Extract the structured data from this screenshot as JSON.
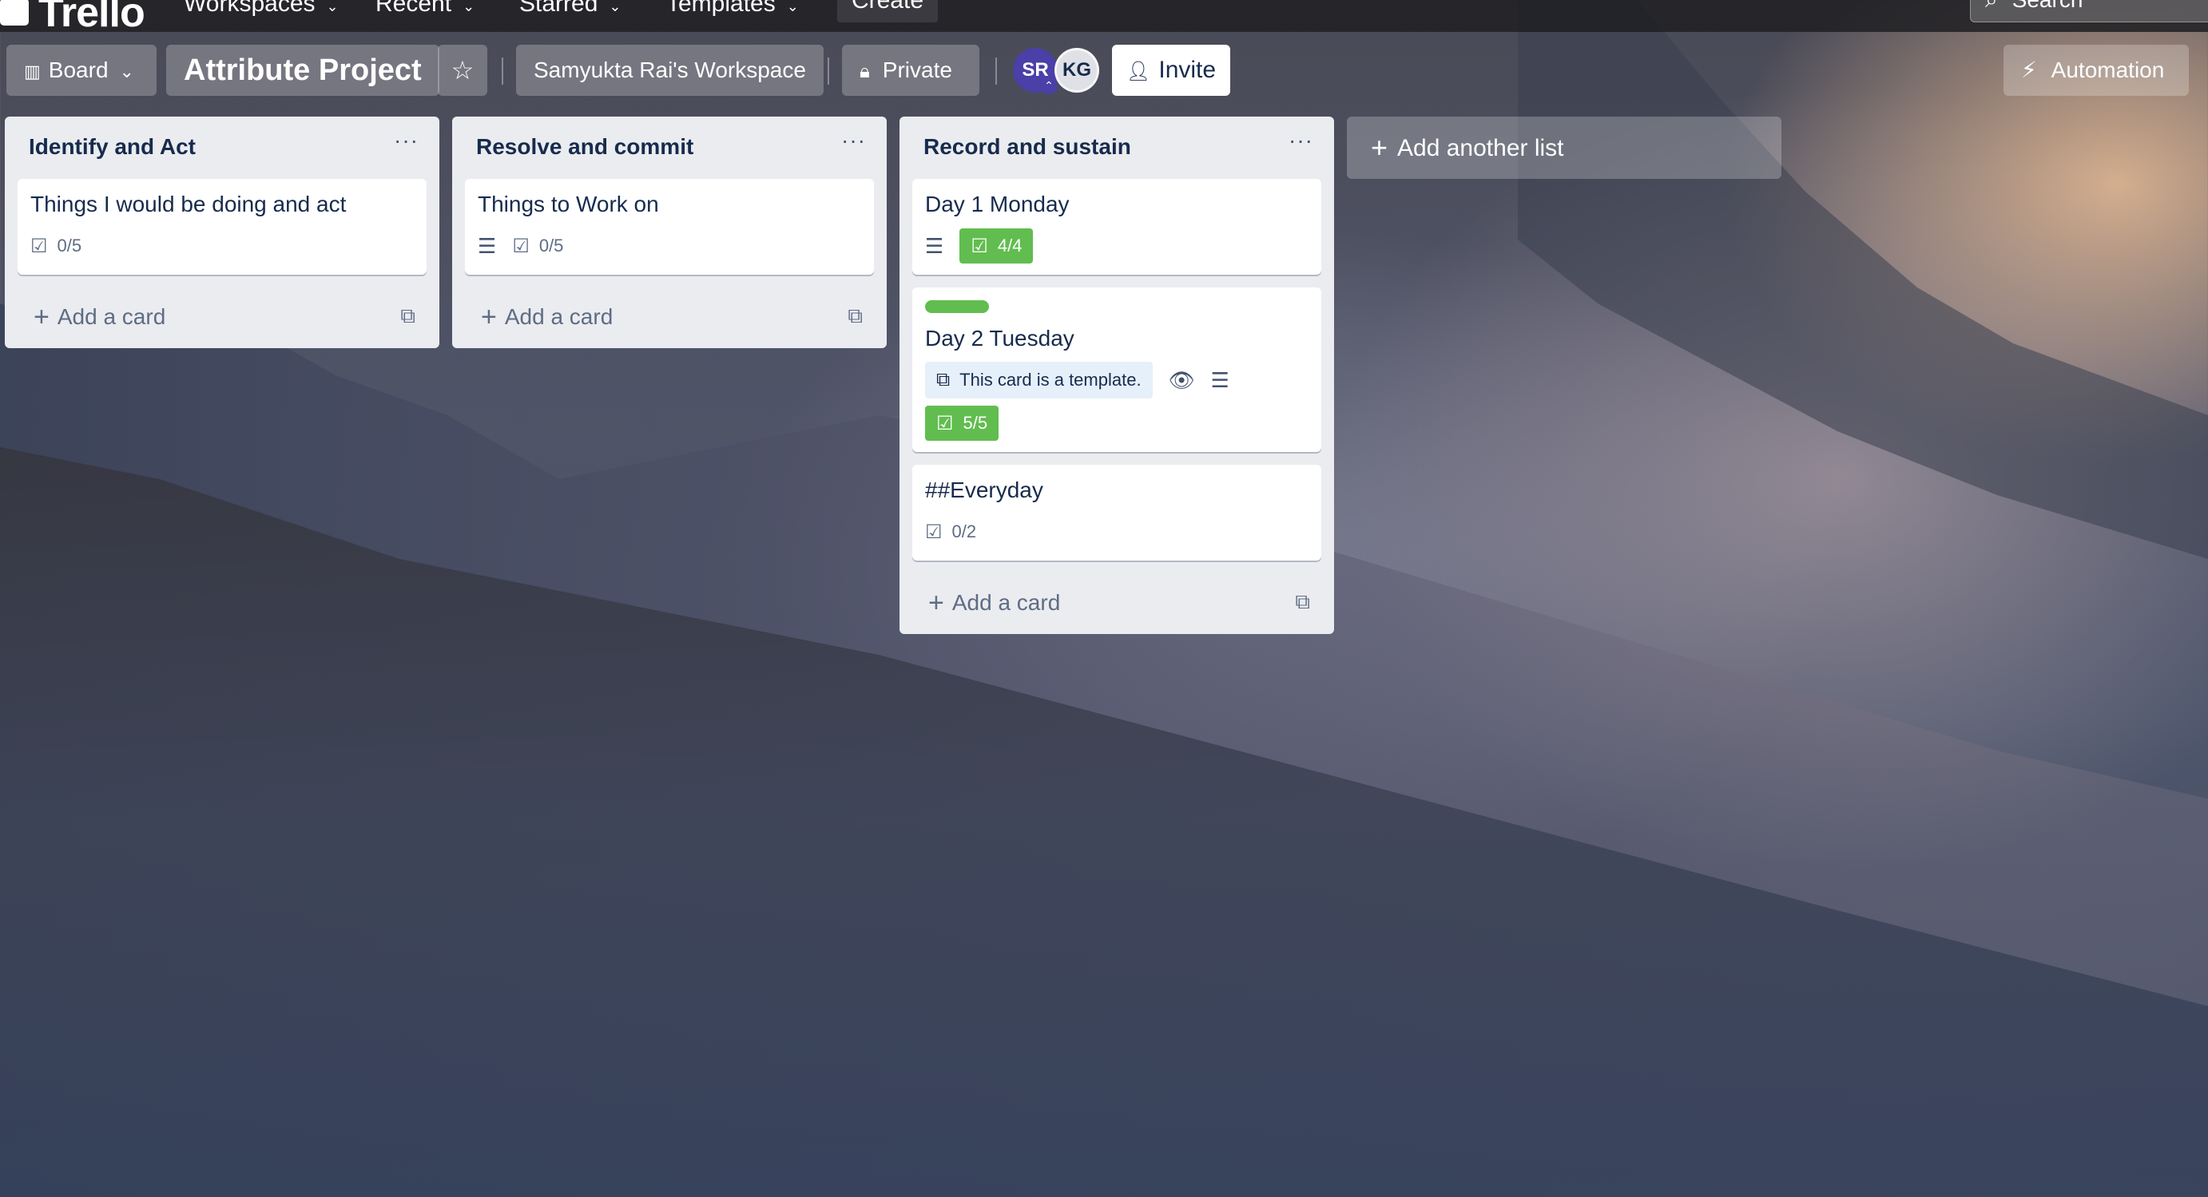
{
  "nav": {
    "logo": "Trello",
    "items": [
      {
        "label": "Workspaces"
      },
      {
        "label": "Recent"
      },
      {
        "label": "Starred"
      },
      {
        "label": "Templates"
      }
    ],
    "create_label": "Create",
    "search_placeholder": "Search"
  },
  "board_header": {
    "view_label": "Board",
    "title": "Attribute Project",
    "star_icon": "star-icon",
    "workspace": "Samyukta Rai's Workspace",
    "visibility": "Private",
    "members": [
      {
        "initials": "SR",
        "color": "#4b3fa8"
      },
      {
        "initials": "KG",
        "color": "#dfe1e6"
      }
    ],
    "invite_label": "Invite",
    "automation_label": "Automation"
  },
  "lists": [
    {
      "title": "Identify and Act",
      "cards": [
        {
          "title": "Things I would be doing and act",
          "checklist": "0/5"
        }
      ],
      "add_card_label": "Add a card"
    },
    {
      "title": "Resolve and commit",
      "cards": [
        {
          "title": "Things to Work on",
          "checklist": "0/5",
          "has_description": true
        }
      ],
      "add_card_label": "Add a card"
    },
    {
      "title": "Record and sustain",
      "cards": [
        {
          "title": "Day 1 Monday",
          "checklist": "4/4",
          "checklist_complete": true,
          "has_description": true
        },
        {
          "title": "Day 2 Tuesday",
          "label_color": "#61bd4f",
          "template_text": "This card is a template.",
          "checklist": "5/5",
          "checklist_complete": true,
          "watching": true,
          "has_description": true
        },
        {
          "title": "##Everyday",
          "checklist": "0/2"
        }
      ],
      "add_card_label": "Add a card"
    }
  ],
  "add_list_label": "Add another list",
  "colors": {
    "list_bg": "#ebecf0",
    "complete_green": "#61bd4f",
    "text_dark": "#172b4d",
    "text_muted": "#5e6c84"
  }
}
